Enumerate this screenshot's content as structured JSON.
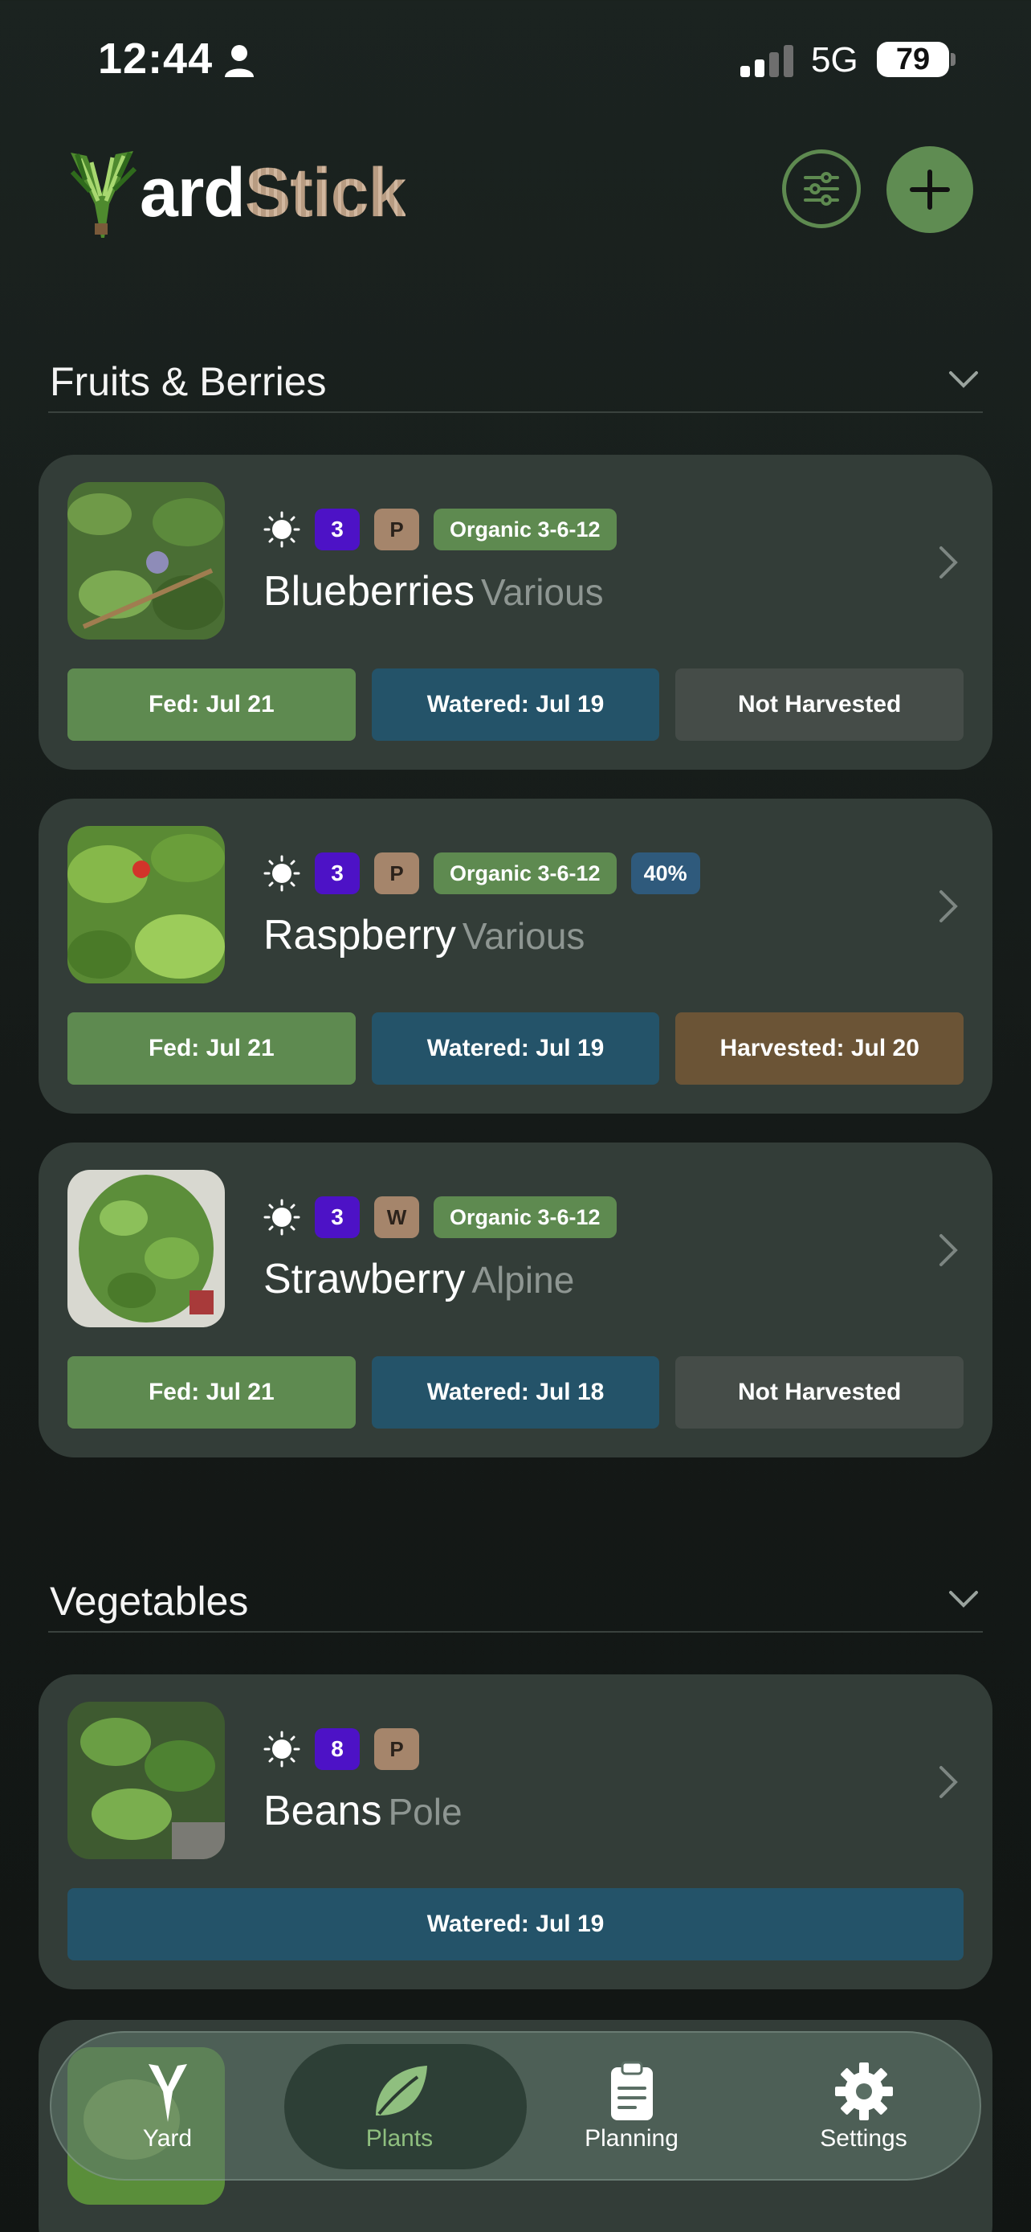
{
  "status_bar": {
    "time": "12:44",
    "network": "5G",
    "battery": "79"
  },
  "app": {
    "logo_letter": "Y",
    "logo_part1": "ard",
    "logo_part2": "Stick"
  },
  "sections": [
    {
      "title": "Fruits & Berries"
    },
    {
      "title": "Vegetables"
    }
  ],
  "plants": [
    {
      "name": "Blueberries",
      "variety": "Various",
      "sun_level": "3",
      "type": "P",
      "fertilizer": "Organic 3-6-12",
      "fed": "Fed: Jul 21",
      "watered": "Watered: Jul 19",
      "harvest": "Not Harvested"
    },
    {
      "name": "Raspberry",
      "variety": "Various",
      "sun_level": "3",
      "type": "P",
      "fertilizer": "Organic 3-6-12",
      "percent": "40%",
      "fed": "Fed: Jul 21",
      "watered": "Watered: Jul 19",
      "harvest": "Harvested: Jul 20"
    },
    {
      "name": "Strawberry",
      "variety": "Alpine",
      "sun_level": "3",
      "type": "W",
      "fertilizer": "Organic 3-6-12",
      "fed": "Fed: Jul 21",
      "watered": "Watered: Jul 18",
      "harvest": "Not Harvested"
    },
    {
      "name": "Beans",
      "variety": "Pole",
      "sun_level": "8",
      "type": "P",
      "watered": "Watered: Jul 19"
    }
  ],
  "tabs": [
    {
      "label": "Yard",
      "icon": "yard-icon"
    },
    {
      "label": "Plants",
      "icon": "leaf-icon",
      "active": true
    },
    {
      "label": "Planning",
      "icon": "clipboard-icon"
    },
    {
      "label": "Settings",
      "icon": "gear-icon"
    }
  ],
  "colors": {
    "fed": "#5e8a50",
    "watered": "#245369",
    "not_harvested": "#454c48",
    "harvested": "#6b5436",
    "sun_badge": "#4d12c6",
    "type_badge": "#a5856b",
    "accent": "#5f8c52"
  }
}
